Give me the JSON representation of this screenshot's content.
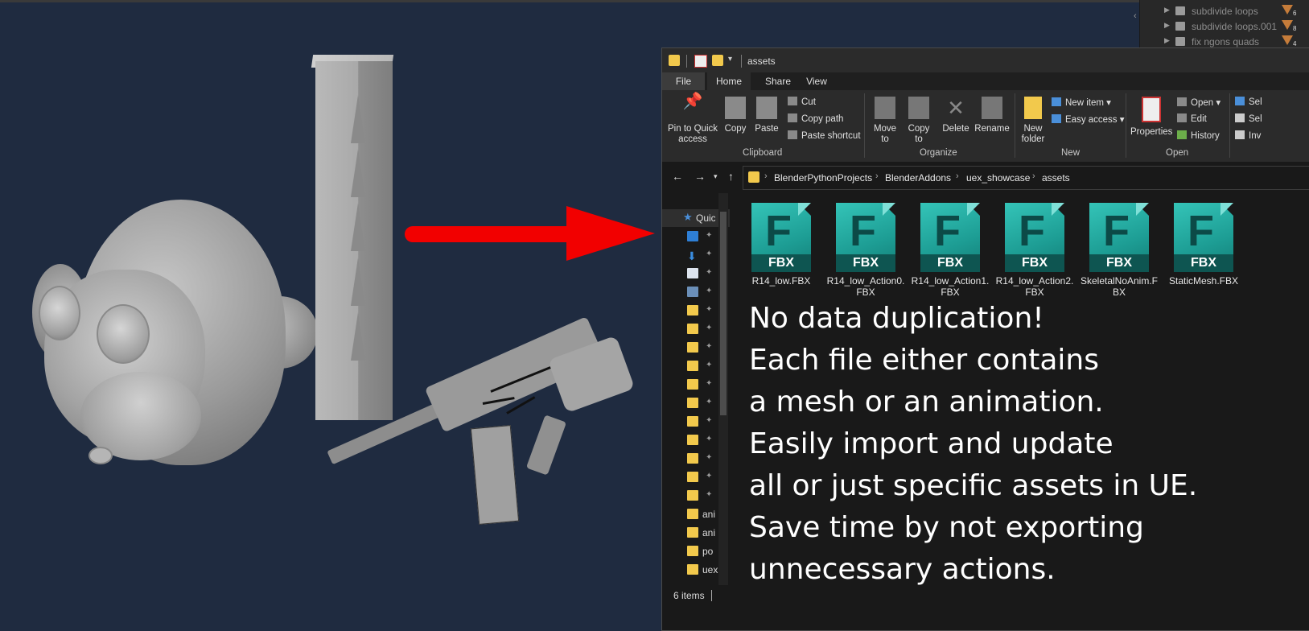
{
  "outliner": {
    "items": [
      {
        "label": "subdivide loops",
        "count": "6"
      },
      {
        "label": "subdivide loops.001",
        "count": "8"
      },
      {
        "label": "fix ngons quads",
        "count": "4"
      }
    ]
  },
  "explorer": {
    "title": "assets",
    "tabs": {
      "file": "File",
      "home": "Home",
      "share": "Share",
      "view": "View"
    },
    "ribbon": {
      "pin": "Pin to Quick access",
      "copy": "Copy",
      "paste": "Paste",
      "cut": "Cut",
      "copy_path": "Copy path",
      "paste_shortcut": "Paste shortcut",
      "group_clipboard": "Clipboard",
      "move_to": "Move to",
      "copy_to": "Copy to",
      "delete": "Delete",
      "rename": "Rename",
      "group_organize": "Organize",
      "new_folder": "New folder",
      "new_item": "New item",
      "easy_access": "Easy access",
      "group_new": "New",
      "properties": "Properties",
      "open": "Open",
      "edit": "Edit",
      "history": "History",
      "group_open": "Open",
      "sel1": "Sel",
      "sel2": "Sel",
      "inv": "Inv"
    },
    "breadcrumb": [
      "BlenderPythonProjects",
      "BlenderAddons",
      "uex_showcase",
      "assets"
    ],
    "nav": {
      "quick": "Quic",
      "items": [
        "ani",
        "ani",
        "po",
        "uex"
      ]
    },
    "files": [
      {
        "ext": "FBX",
        "name": "R14_low.FBX"
      },
      {
        "ext": "FBX",
        "name": "R14_low_Action0.FBX"
      },
      {
        "ext": "FBX",
        "name": "R14_low_Action1.FBX"
      },
      {
        "ext": "FBX",
        "name": "R14_low_Action2.FBX"
      },
      {
        "ext": "FBX",
        "name": "SkeletalNoAnim.FBX"
      },
      {
        "ext": "FBX",
        "name": "StaticMesh.FBX"
      }
    ],
    "status": "6 items"
  },
  "overlay_lines": [
    "No data duplication!",
    "Each file either contains",
    "a mesh or an animation.",
    "Easily import and update",
    "all or just specific assets in UE.",
    "Save time by not exporting",
    "unnecessary actions."
  ],
  "colors": {
    "viewport_bg": "#1f2b40",
    "arrow": "#f20000",
    "fbx_teal": "#1d9d94",
    "folder": "#f2c94c"
  }
}
